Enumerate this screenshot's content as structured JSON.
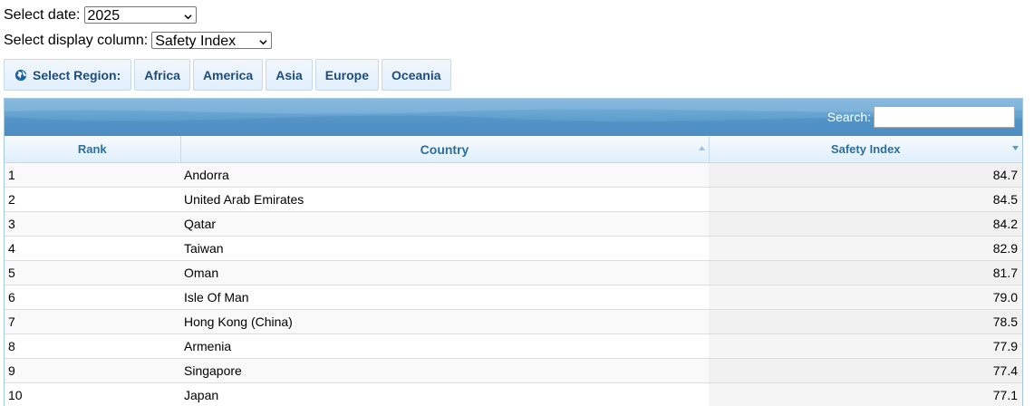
{
  "controls": {
    "date_label": "Select date:",
    "date_value": "2025",
    "column_label": "Select display column:",
    "column_value": "Safety Index"
  },
  "regions": {
    "select_label": "Select Region:",
    "buttons": [
      "Africa",
      "America",
      "Asia",
      "Europe",
      "Oceania"
    ]
  },
  "search": {
    "label": "Search:",
    "value": ""
  },
  "table": {
    "headers": [
      "Rank",
      "Country",
      "Safety Index"
    ],
    "rows": [
      {
        "rank": "1",
        "country": "Andorra",
        "value": "84.7"
      },
      {
        "rank": "2",
        "country": "United Arab Emirates",
        "value": "84.5"
      },
      {
        "rank": "3",
        "country": "Qatar",
        "value": "84.2"
      },
      {
        "rank": "4",
        "country": "Taiwan",
        "value": "82.9"
      },
      {
        "rank": "5",
        "country": "Oman",
        "value": "81.7"
      },
      {
        "rank": "6",
        "country": "Isle Of Man",
        "value": "79.0"
      },
      {
        "rank": "7",
        "country": "Hong Kong (China)",
        "value": "78.5"
      },
      {
        "rank": "8",
        "country": "Armenia",
        "value": "77.9"
      },
      {
        "rank": "9",
        "country": "Singapore",
        "value": "77.4"
      },
      {
        "rank": "10",
        "country": "Japan",
        "value": "77.1"
      }
    ]
  },
  "icons": {
    "globe": "globe-icon",
    "dropdown": "chevron-down-icon",
    "sort_asc": "sort-ascending-icon",
    "sort_desc": "sort-descending-icon"
  },
  "colors": {
    "header_text": "#2e6e9e",
    "toolbar_blue": "#5c9ccc",
    "button_text": "#1d4d7e"
  }
}
